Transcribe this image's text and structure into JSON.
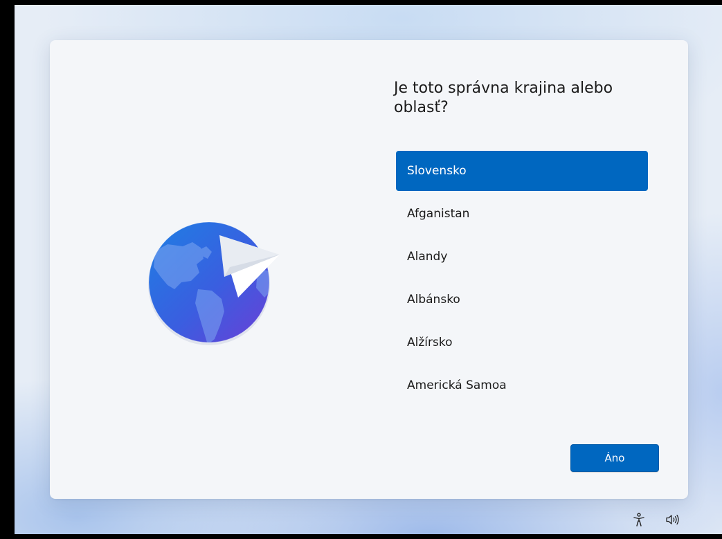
{
  "page": {
    "title": "Je toto správna krajina alebo oblasť?"
  },
  "regions": [
    {
      "label": "Slovensko",
      "selected": true
    },
    {
      "label": "Afganistan",
      "selected": false
    },
    {
      "label": "Alandy",
      "selected": false
    },
    {
      "label": "Albánsko",
      "selected": false
    },
    {
      "label": "Alžírsko",
      "selected": false
    },
    {
      "label": "Americká Samoa",
      "selected": false
    }
  ],
  "actions": {
    "confirm_label": "Áno"
  },
  "icons": {
    "illustration": "globe-with-paper-plane-icon",
    "accessibility": "accessibility-icon",
    "volume": "volume-icon"
  },
  "colors": {
    "accent": "#0067c0",
    "text": "#1b1b1b",
    "card_background": "#f4f6f9"
  }
}
